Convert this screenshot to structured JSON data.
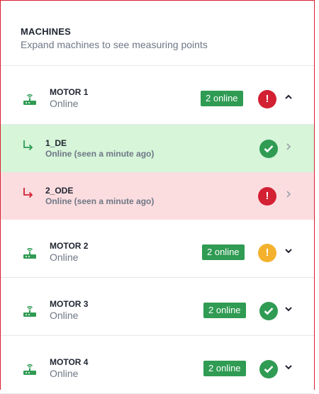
{
  "header": {
    "title": "MACHINES",
    "subtitle": "Expand machines to see measuring points"
  },
  "machines": [
    {
      "name": "MOTOR 1",
      "status": "Online",
      "badge": "2 online",
      "state": "error",
      "expanded": true,
      "points": [
        {
          "name": "1_DE",
          "status": "Online (seen a minute ago)",
          "state": "ok"
        },
        {
          "name": "2_ODE",
          "status": "Online (seen a minute ago)",
          "state": "error"
        }
      ]
    },
    {
      "name": "MOTOR 2",
      "status": "Online",
      "badge": "2 online",
      "state": "warning",
      "expanded": false
    },
    {
      "name": "MOTOR 3",
      "status": "Online",
      "badge": "2 online",
      "state": "ok",
      "expanded": false
    },
    {
      "name": "MOTOR 4",
      "status": "Online",
      "badge": "2 online",
      "state": "ok",
      "expanded": false
    }
  ],
  "icons": {
    "machine": "router-wifi-icon",
    "error": "exclamation-circle-icon",
    "warning": "exclamation-circle-icon",
    "ok": "check-circle-icon",
    "expand": "chevron-down-icon",
    "collapse": "chevron-up-icon",
    "point": "subdirectory-arrow-icon",
    "open_point": "chevron-right-icon"
  },
  "colors": {
    "online_badge": "#2f9b53",
    "error": "#d32033",
    "warning": "#f3b12d",
    "ok": "#2f9b53",
    "ok_row": "#d6f5d9",
    "error_row": "#fbdde0",
    "panel_border": "#d8202f"
  }
}
